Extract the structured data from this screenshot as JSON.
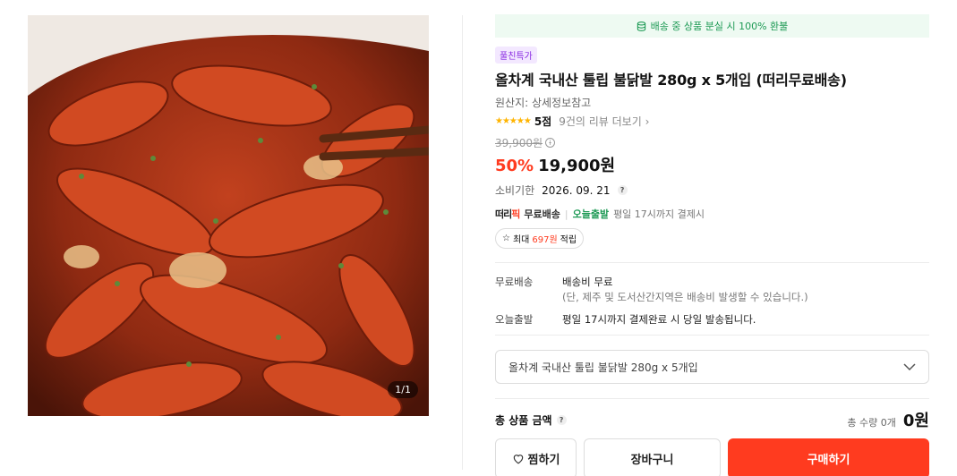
{
  "product": {
    "image_counter": "1/1",
    "guarantee": "배송 중 상품 분실 시 100% 환불",
    "badge": "풀친특가",
    "title": "올차계 국내산 툴립 불닭발 280g x 5개입 (떠리무료배송)",
    "origin": "원산지: 상세정보참고",
    "rating_score": "5점",
    "review_text": "9건의 리뷰 더보기",
    "original_price": "39,900원",
    "discount": "50%",
    "price": "19,900원",
    "expiry_label": "소비기한",
    "expiry_value": "2026. 09. 21",
    "shipping": {
      "brand_prefix": "떠리",
      "brand_suffix": "픽",
      "free_label": "무료배송",
      "today_label": "오늘출발",
      "note": "평일 17시까지 결제시"
    },
    "points": {
      "prefix": "최대",
      "amount": "697원",
      "suffix": "적립"
    }
  },
  "delivery_info": [
    {
      "key": "무료배송",
      "value": "배송비 무료",
      "sub": "(단, 제주 및 도서산간지역은 배송비 발생할 수 있습니다.)"
    },
    {
      "key": "오늘출발",
      "value": "평일 17시까지 결제완료 시 당일 발송됩니다.",
      "sub": ""
    }
  ],
  "option_select": {
    "value": "올차계 국내산 툴립 불닭발 280g x 5개입"
  },
  "total": {
    "label": "총 상품 금액",
    "qty": "총 수량 0개",
    "amount": "0원"
  },
  "buttons": {
    "wish": "찜하기",
    "cart": "장바구니",
    "buy": "구매하기"
  },
  "colors": {
    "accent": "#ff3b1f",
    "green": "#1e9a55",
    "purple": "#8a2be2",
    "star": "#ffb400"
  }
}
